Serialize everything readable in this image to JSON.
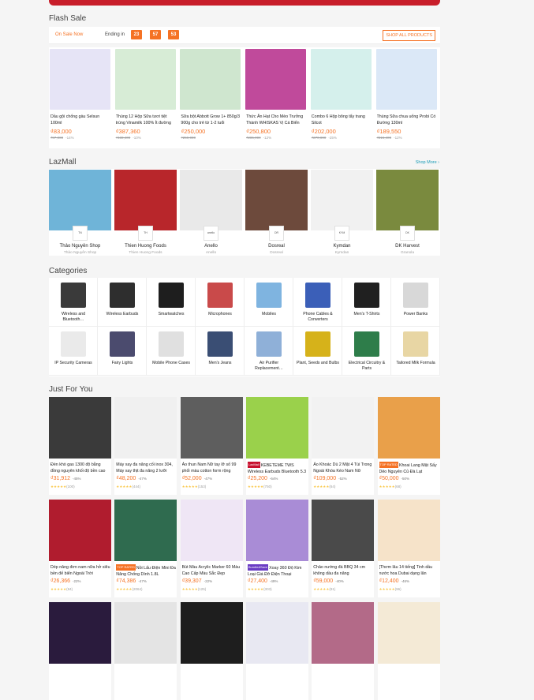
{
  "flash_sale": {
    "title": "Flash Sale",
    "on_sale_now": "On Sale Now",
    "ending_in": "Ending in",
    "timer": [
      "23",
      "57",
      "53"
    ],
    "shop_all": "SHOP ALL PRODUCTS",
    "products": [
      {
        "name": "Dầu gội chống gàu Selsun 100ml",
        "price": "₫83,000",
        "old_price": "₫97,000",
        "discount": "-14%",
        "img_bg": "#e6e4f6"
      },
      {
        "name": "Thùng 12 Hộp Sữa tươi tiệt trùng Vinamilk 100% Ít đường 180ml",
        "price": "₫387,360",
        "old_price": "₫430,400",
        "discount": "-10%",
        "img_bg": "#d7ecd6"
      },
      {
        "name": "Sữa bột Abbott Grow 1+ 850g/3 900g cho trẻ từ 1-2 tuổi",
        "price": "₫250,000",
        "old_price": "₫259,000",
        "discount": "",
        "img_bg": "#cfe6cf"
      },
      {
        "name": "Thức Ăn Hạt Cho Mèo Trưởng Thành WHISKAS Vị Cá Biển",
        "price": "₫250,800",
        "old_price": "₫285,000",
        "discount": "-12%",
        "img_bg": "#c04a9b"
      },
      {
        "name": "Combo 6 Hộp bông tẩy trang Silcot",
        "price": "₫202,000",
        "old_price": "₫270,000",
        "discount": "-25%",
        "img_bg": "#d5f0ec"
      },
      {
        "name": "Thùng Sữa chua uống Probi Có Đường 130ml",
        "price": "₫189,550",
        "old_price": "₫215,400",
        "discount": "-12%",
        "img_bg": "#dbe8f7"
      }
    ]
  },
  "lazmall": {
    "title": "LazMall",
    "shop_more": "Shop More ›",
    "stores": [
      {
        "name": "Thảo Nguyên Shop",
        "sub": "Thảo Nguyên Shop",
        "logo": "TN",
        "img_bg": "#6fb4d8"
      },
      {
        "name": "Thien Huong Foods",
        "sub": "Thien Huong Foods",
        "logo": "TH",
        "img_bg": "#b8262b"
      },
      {
        "name": "Anello",
        "sub": "Anello",
        "logo": "anello",
        "img_bg": "#e9e9e9"
      },
      {
        "name": "Dosreal",
        "sub": "Dosreal",
        "logo": "DR",
        "img_bg": "#6d4a3c"
      },
      {
        "name": "Kymdan",
        "sub": "Kymdan",
        "logo": "KYM",
        "img_bg": "#f1f1f1"
      },
      {
        "name": "DK Harvest",
        "sub": "Granola",
        "logo": "DK",
        "img_bg": "#7a8a3e"
      }
    ]
  },
  "categories": {
    "title": "Categories",
    "items": [
      {
        "label": "Wireless and Bluetooth…",
        "color": "#3a3a3a"
      },
      {
        "label": "Wireless Earbuds",
        "color": "#2e2e2e"
      },
      {
        "label": "Smartwatches",
        "color": "#1e1e1e"
      },
      {
        "label": "Microphones",
        "color": "#c94a4a"
      },
      {
        "label": "Mobiles",
        "color": "#7fb4e0"
      },
      {
        "label": "Phone Cables & Converters",
        "color": "#3b5fb8"
      },
      {
        "label": "Men's T-Shirts",
        "color": "#202020"
      },
      {
        "label": "Power Banks",
        "color": "#d8d8d8"
      },
      {
        "label": "IP Security Cameras",
        "color": "#eaeaea"
      },
      {
        "label": "Fairy Lights",
        "color": "#4b4b6e"
      },
      {
        "label": "Mobile Phone Cases",
        "color": "#e0e0e0"
      },
      {
        "label": "Men's Jeans",
        "color": "#3a4e74"
      },
      {
        "label": "Air Purifier Replacement…",
        "color": "#8fb0d8"
      },
      {
        "label": "Plant, Seeds and Bulbs",
        "color": "#d6b21a"
      },
      {
        "label": "Electrical Circuitry & Parts",
        "color": "#2e7d4a"
      },
      {
        "label": "Tailored Milk Formula",
        "color": "#e8d6a4"
      }
    ]
  },
  "just_for_you": {
    "title": "Just For You",
    "products": [
      {
        "tag": "",
        "tag_color": "",
        "name": "Đèn khò gas 1300 độ bằng đồng nguyên khối độ bền cao",
        "price": "₫31,912",
        "discount": "-45%",
        "rating": "★★★★★",
        "reviews": "(100)",
        "img_bg": "#3a3a3a"
      },
      {
        "tag": "",
        "tag_color": "",
        "name": "Máy xay đa năng cối inox 304, Máy xay thịt đa năng 2 lưỡi",
        "price": "₫48,200",
        "discount": "-47%",
        "rating": "★★★★★",
        "reviews": "(444)",
        "img_bg": "#f0f0f0"
      },
      {
        "tag": "",
        "tag_color": "",
        "name": "Áo thun Nam Nữ tay lỡ số 99 phối màu cotton form rộng",
        "price": "₫52,000",
        "discount": "-47%",
        "rating": "★★★★★",
        "reviews": "(153)",
        "img_bg": "#5e5e5e"
      },
      {
        "tag": "LazMall",
        "tag_color": "#c8102e",
        "name": "KEBETEME TWS Wireless Earbuds Bluetooth 5.3",
        "price": "₫25,200",
        "discount": "-64%",
        "rating": "★★★★★",
        "reviews": "(750)",
        "img_bg": "#9ad14b"
      },
      {
        "tag": "",
        "tag_color": "",
        "name": "Áo Khoác Dù 2 Mặt 4 Túi Trong Ngoài Khóa Kéo Nam Nữ",
        "price": "₫109,000",
        "discount": "-52%",
        "rating": "★★★★★",
        "reviews": "(64)",
        "img_bg": "#f2f2f2"
      },
      {
        "tag": "TOP RATED",
        "tag_color": "#f57224",
        "name": "Khoai Lang Mật Sấy Dẻo Nguyên Củ Đà Lạt",
        "price": "₫50,000",
        "discount": "-50%",
        "rating": "★★★★★",
        "reviews": "(68)",
        "img_bg": "#e9a04a"
      },
      {
        "tag": "",
        "tag_color": "",
        "name": "Dép nâng đơn nam nữa hở siêu bền đế biển Ngoài Trời",
        "price": "₫26,366",
        "discount": "-22%",
        "rating": "★★★★★",
        "reviews": "(94)",
        "img_bg": "#b01c2e"
      },
      {
        "tag": "TOP RATED",
        "tag_color": "#f57224",
        "name": "Nồi Lẩu Điện Mini Đa Năng Chống Dính 1.8L",
        "price": "₫74,386",
        "discount": "-47%",
        "rating": "★★★★★",
        "reviews": "(2064)",
        "img_bg": "#2f6b4f"
      },
      {
        "tag": "",
        "tag_color": "",
        "name": "Bút Màu Acrylic Marker 60 Màu Cao Cấp Màu Sắc Đẹp",
        "price": "₫39,307",
        "discount": "-22%",
        "rating": "★★★★★",
        "reviews": "(125)",
        "img_bg": "#efe6f5"
      },
      {
        "tag": "Bundle&Save",
        "tag_color": "#6a3cc4",
        "name": "Xoay 360 Độ Kim Loại Giá Đỡ Điện Thoại",
        "price": "₫27,400",
        "discount": "-49%",
        "rating": "★★★★★",
        "reviews": "(303)",
        "img_bg": "#a98cd6"
      },
      {
        "tag": "",
        "tag_color": "",
        "name": "Chảo nướng đá BBQ 34 cm không dầu đa năng",
        "price": "₫59,000",
        "discount": "-40%",
        "rating": "★★★★★",
        "reviews": "(91)",
        "img_bg": "#4a4a4a"
      },
      {
        "tag": "",
        "tag_color": "",
        "name": "[Thơm lâu 14 tiếng] Tinh dầu nước hoa Dubai dạng lăn",
        "price": "₫12,400",
        "discount": "-46%",
        "rating": "★★★★★",
        "reviews": "(96)",
        "img_bg": "#f6e3c9"
      },
      {
        "tag": "",
        "tag_color": "",
        "name": "",
        "price": "",
        "discount": "",
        "rating": "",
        "reviews": "",
        "img_bg": "#2a1b3d"
      },
      {
        "tag": "",
        "tag_color": "",
        "name": "",
        "price": "",
        "discount": "",
        "rating": "",
        "reviews": "",
        "img_bg": "#e4e4e4"
      },
      {
        "tag": "",
        "tag_color": "",
        "name": "",
        "price": "",
        "discount": "",
        "rating": "",
        "reviews": "",
        "img_bg": "#1e1e1e"
      },
      {
        "tag": "",
        "tag_color": "",
        "name": "",
        "price": "",
        "discount": "",
        "rating": "",
        "reviews": "",
        "img_bg": "#e8e8f2"
      },
      {
        "tag": "",
        "tag_color": "",
        "name": "",
        "price": "",
        "discount": "",
        "rating": "",
        "reviews": "",
        "img_bg": "#b36a88"
      },
      {
        "tag": "",
        "tag_color": "",
        "name": "",
        "price": "",
        "discount": "",
        "rating": "",
        "reviews": "",
        "img_bg": "#f4ead6"
      }
    ]
  },
  "colors": {
    "accent": "#f57224",
    "link": "#1a9cb7",
    "banner": "#c81e2a"
  }
}
